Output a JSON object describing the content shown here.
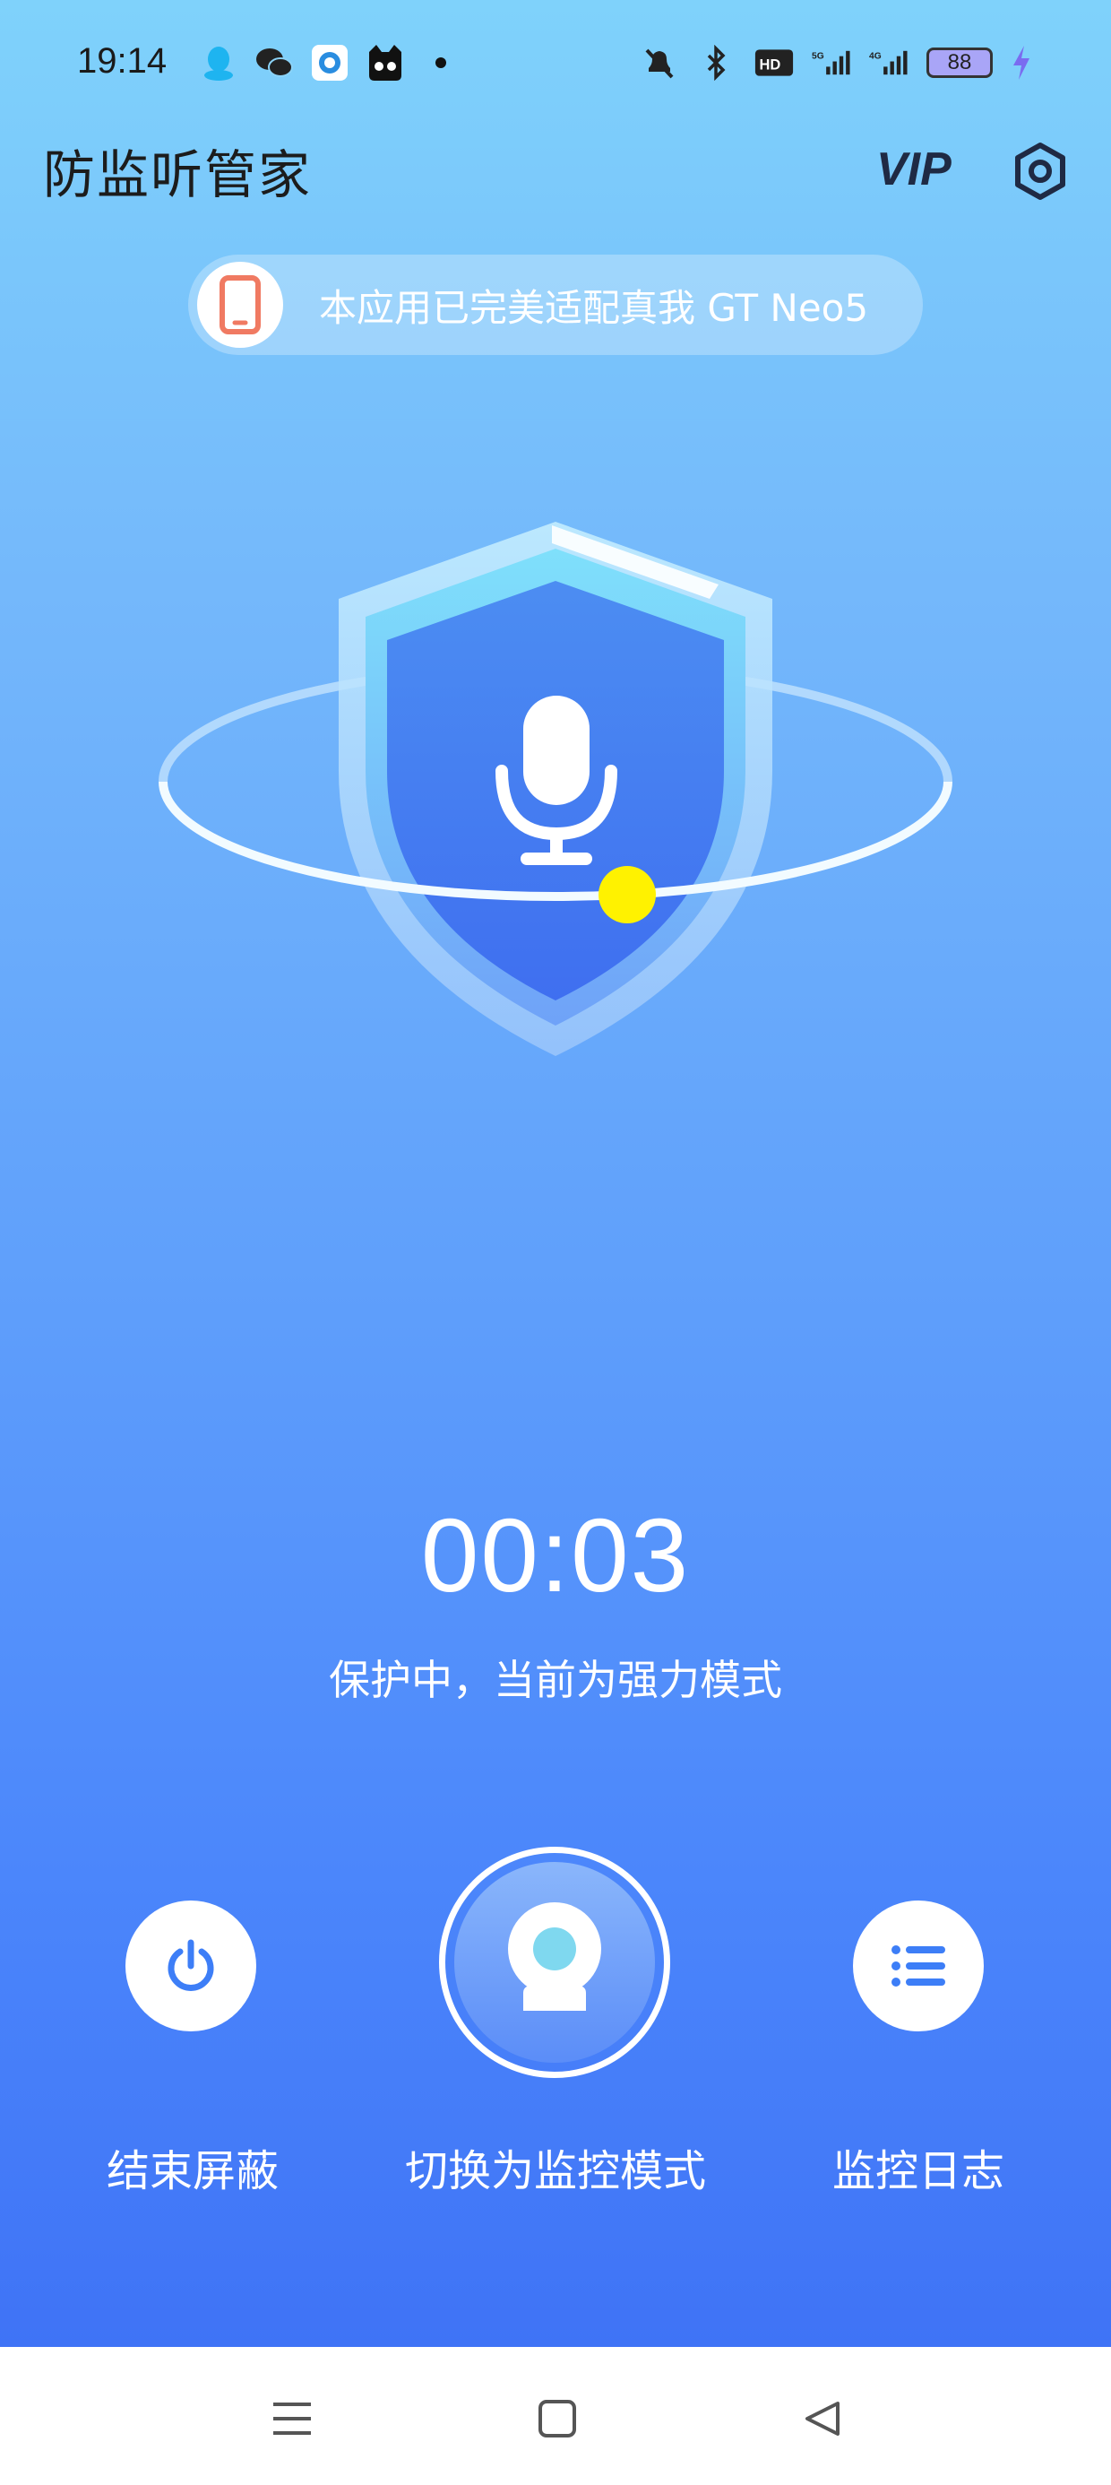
{
  "status_bar": {
    "time": "19:14",
    "battery": "88",
    "icons_left": [
      "qq-icon",
      "wechat-icon",
      "app-circle-icon",
      "cat-app-icon",
      "dot-icon"
    ],
    "icons_right": [
      "mute-icon",
      "bluetooth-icon",
      "hd-icon",
      "5g-signal-icon",
      "4g-signal-icon",
      "battery-icon",
      "charging-icon"
    ]
  },
  "header": {
    "title": "防监听管家",
    "vip_label": "VIP"
  },
  "banner": {
    "text": "本应用已完美适配真我 GT Neo5"
  },
  "protection": {
    "timer": "00:03",
    "status": "保护中，当前为强力模式"
  },
  "actions": {
    "end_label": "结束屏蔽",
    "switch_label": "切换为监控模式",
    "log_label": "监控日志"
  },
  "colors": {
    "accent": "#4b86fb",
    "orbit_dot": "#fff200",
    "banner_icon": "#f07a62"
  }
}
